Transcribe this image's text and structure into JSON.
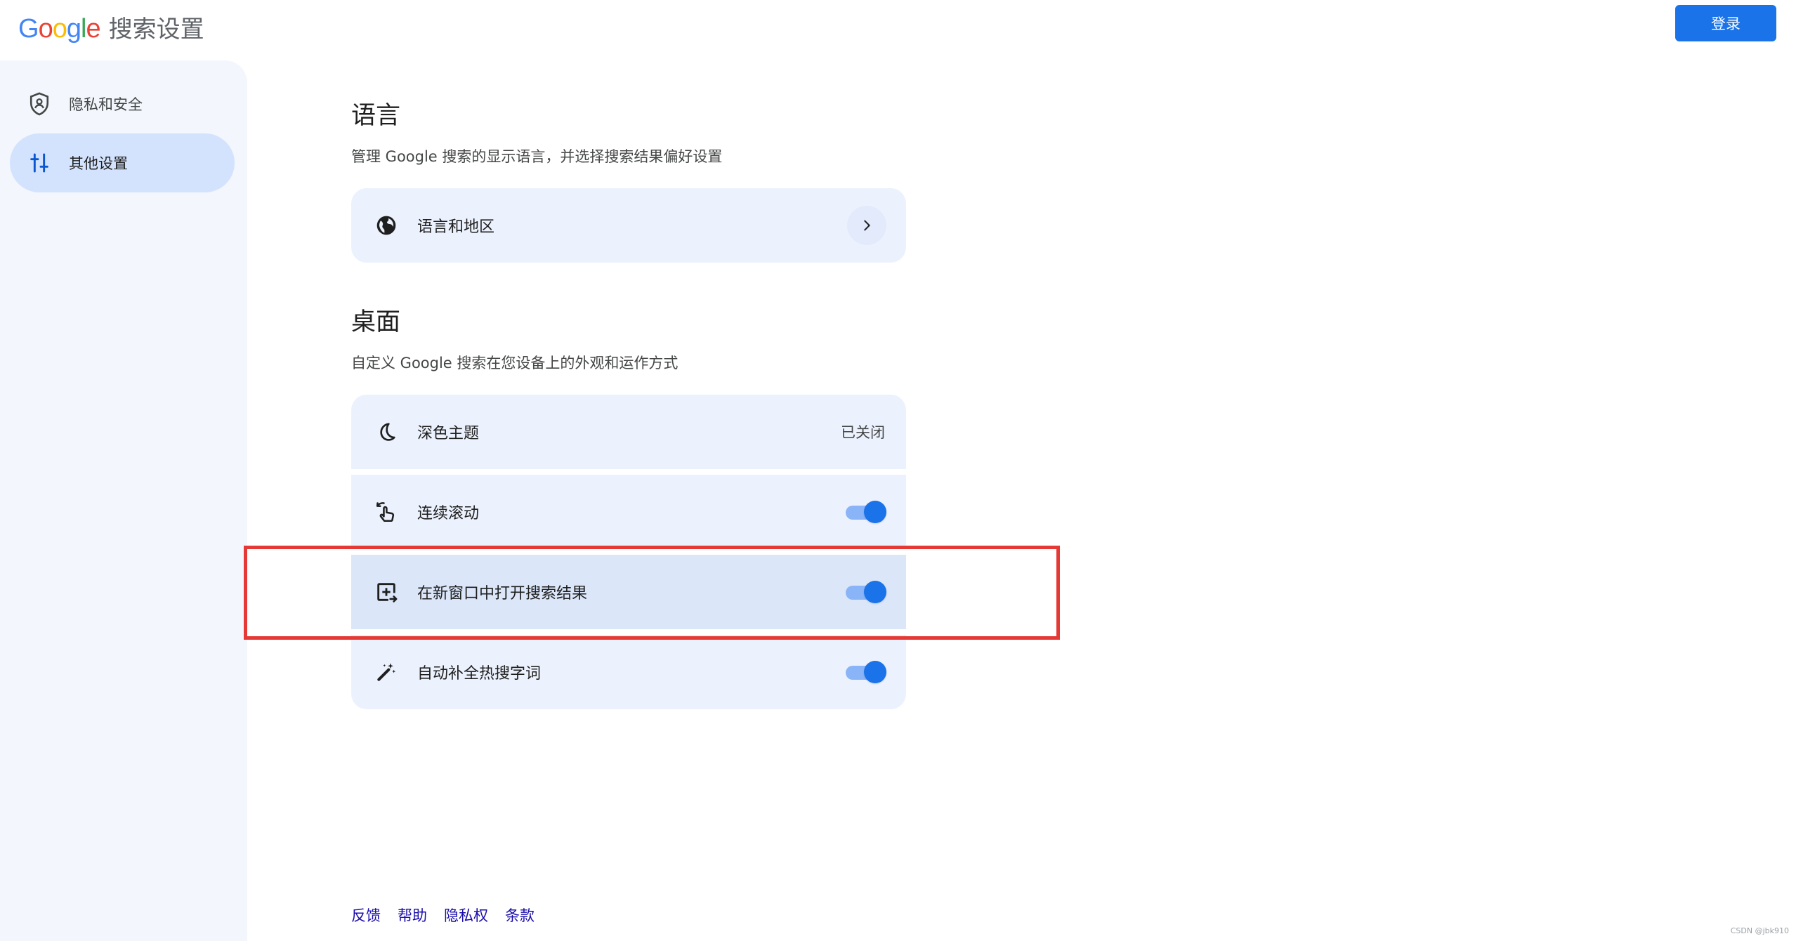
{
  "header": {
    "logo_letters": [
      {
        "char": "G",
        "color": "#4285f4"
      },
      {
        "char": "o",
        "color": "#ea4335"
      },
      {
        "char": "o",
        "color": "#fbbc05"
      },
      {
        "char": "g",
        "color": "#4285f4"
      },
      {
        "char": "l",
        "color": "#34a853"
      },
      {
        "char": "e",
        "color": "#ea4335"
      }
    ],
    "title": "搜索设置",
    "login_label": "登录"
  },
  "sidebar": {
    "items": [
      {
        "label": "隐私和安全",
        "icon": "shield-icon",
        "active": false
      },
      {
        "label": "其他设置",
        "icon": "sliders-icon",
        "active": true
      }
    ]
  },
  "sections": {
    "language": {
      "title": "语言",
      "description": "管理 Google 搜索的显示语言，并选择搜索结果偏好设置",
      "rows": [
        {
          "label": "语言和地区",
          "icon": "globe-icon",
          "trailing": "chevron-right-icon"
        }
      ]
    },
    "desktop": {
      "title": "桌面",
      "description": "自定义 Google 搜索在您设备上的外观和运作方式",
      "rows": [
        {
          "label": "深色主题",
          "icon": "moon-icon",
          "status": "已关闭"
        },
        {
          "label": "连续滚动",
          "icon": "scroll-gesture-icon",
          "toggle": true
        },
        {
          "label": "在新窗口中打开搜索结果",
          "icon": "new-window-icon",
          "toggle": true
        },
        {
          "label": "自动补全热搜字词",
          "icon": "magic-wand-icon",
          "toggle": true
        }
      ]
    }
  },
  "footer": {
    "links": [
      "反馈",
      "帮助",
      "隐私权",
      "条款"
    ]
  },
  "watermark": "CSDN @jbk910",
  "colors": {
    "accent": "#1a73e8",
    "card_bg": "#ecf2fd",
    "sidebar_bg": "#f3f6fc",
    "sidebar_active": "#d3e3fd",
    "annotation": "#e53935"
  }
}
